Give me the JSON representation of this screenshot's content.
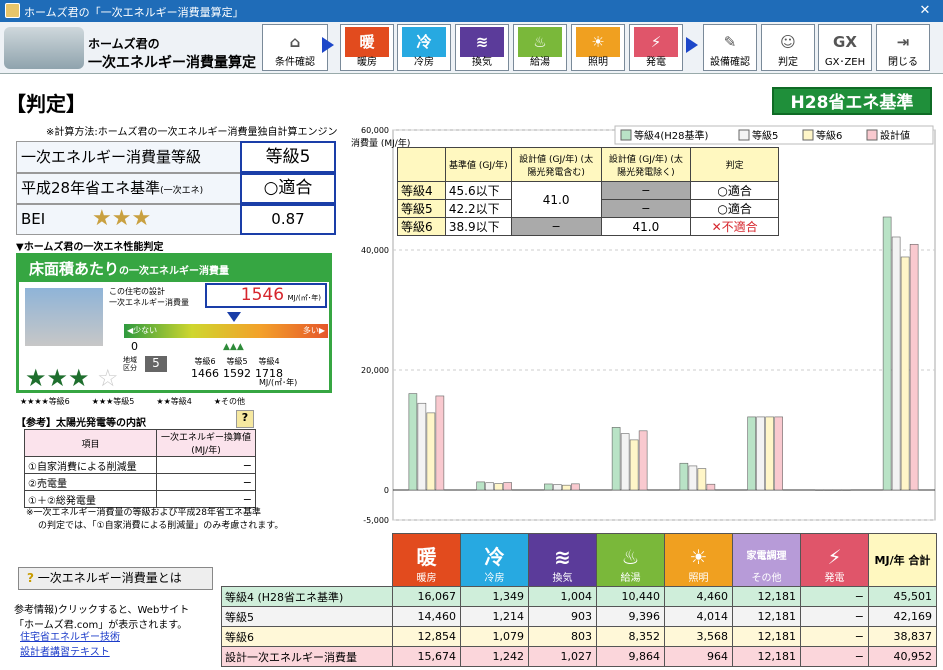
{
  "window": {
    "title": "ホームズ君の「一次エネルギー消費量算定」",
    "close": "✕"
  },
  "logo": {
    "line1": "ホームズ君の",
    "line2": "一次エネルギー消費量算定"
  },
  "toolbar": {
    "buttons": [
      {
        "label": "条件確認",
        "icon": "⌂",
        "color": "#ffffff"
      },
      {
        "label": "暖房",
        "icon": "暖",
        "color": "#e24b1e"
      },
      {
        "label": "冷房",
        "icon": "冷",
        "color": "#27a9e1"
      },
      {
        "label": "換気",
        "icon": "≋",
        "color": "#5b3b9a"
      },
      {
        "label": "給湯",
        "icon": "♨",
        "color": "#7ab83a"
      },
      {
        "label": "照明",
        "icon": "☀",
        "color": "#f0a020"
      },
      {
        "label": "発電",
        "icon": "⚡",
        "color": "#e0556a"
      },
      {
        "label": "設備確認",
        "icon": "✎",
        "color": "#ffffff"
      },
      {
        "label": "判定",
        "icon": "☺",
        "color": "#ffffff"
      },
      {
        "label": "GX･ZEH",
        "icon": "GX",
        "color": "#ffffff"
      },
      {
        "label": "閉じる",
        "icon": "⇥",
        "color": "#ffffff"
      }
    ]
  },
  "page": {
    "title": "【判定】",
    "badge": "H28省エネ基準",
    "method_note": "※計算方法:ホームズ君の一次エネルギー消費量独自計算エンジン"
  },
  "summary": {
    "grade_label": "一次エネルギー消費量等級",
    "grade_value": "等級5",
    "h28_label": "平成28年省エネ基準",
    "h28_sub": "(一次エネ)",
    "h28_value": "○適合",
    "bei_label": "BEI",
    "bei_stars": "★★★",
    "bei_value": "0.87"
  },
  "performance": {
    "heading": "▼ホームズ君の一次エネ性能判定",
    "box_title": "床面積あたり",
    "box_title2": "の一次エネルギー消費量",
    "design_label1": "この住宅の設計",
    "design_label2": "一次エネルギー消費量",
    "design_value": "1546",
    "design_unit": "MJ/(㎡･年)",
    "scale_low": "◀少ない",
    "scale_high": "多い▶",
    "scale_zero": "0",
    "region_label": "地域区分",
    "region_value": "5",
    "grades": [
      {
        "name": "等級6",
        "value": "1466"
      },
      {
        "name": "等級5",
        "value": "1592"
      },
      {
        "name": "等級4",
        "value": "1718"
      }
    ],
    "grade_unit": "MJ/(㎡･年)",
    "stars": "★★★",
    "stars_empty": "☆",
    "legend": [
      "★★★★等級6",
      "★★★等級5",
      "★★等級4",
      "★その他"
    ]
  },
  "solar": {
    "heading": "【参考】太陽光発電等の内訳",
    "col1": "項目",
    "col2": "一次エネルギー換算値 (MJ/年)",
    "rows": [
      {
        "item": "①自家消費による削減量",
        "value": "−"
      },
      {
        "item": "②売電量",
        "value": "−"
      },
      {
        "item": "①＋②総発電量",
        "value": "−"
      }
    ],
    "note1": "※一次エネルギー消費量の等級および平成28年省エネ基準",
    "note2": "の判定では、「①自家消費による削減量」のみ考慮されます。"
  },
  "help": {
    "button": "一次エネルギー消費量とは",
    "info": "参考情報)クリックすると、Webサイト",
    "info2": "「ホームズ君.com」が表示されます。",
    "link1": "住宅省エネルギー技術",
    "link2": "設計者講習テキスト"
  },
  "judge_table": {
    "headers": [
      "基準値 (GJ/年)",
      "設計値 (GJ/年) (太陽光発電含む)",
      "設計値 (GJ/年) (太陽光発電除く)",
      "判定"
    ],
    "rows": [
      {
        "grade": "等級4",
        "base": "45.6以下",
        "with": "41.0",
        "without": "−",
        "result": "○適合"
      },
      {
        "grade": "等級5",
        "base": "42.2以下",
        "with": "",
        "without": "−",
        "result": "○適合"
      },
      {
        "grade": "等級6",
        "base": "38.9以下",
        "with": "−",
        "without": "41.0",
        "result": "✕不適合"
      }
    ]
  },
  "chart_data": {
    "type": "bar",
    "ylabel": "消費量 (MJ/年)",
    "ylim": [
      -5000,
      60000
    ],
    "yticks": [
      "60,000",
      "40,000",
      "20,000",
      "0",
      "-5,000"
    ],
    "categories": [
      "暖房",
      "冷房",
      "換気",
      "給湯",
      "照明",
      "その他",
      "発電",
      "合計"
    ],
    "series": [
      {
        "name": "等級4(H28基準)",
        "color": "#b9e3c6",
        "values": [
          16067,
          1349,
          1004,
          10440,
          4460,
          12181,
          0,
          45501
        ]
      },
      {
        "name": "等級5",
        "color": "#f3f3f3",
        "values": [
          14460,
          1214,
          903,
          9396,
          4014,
          12181,
          0,
          42169
        ]
      },
      {
        "name": "等級6",
        "color": "#fff6c8",
        "values": [
          12854,
          1079,
          803,
          8352,
          3568,
          12181,
          0,
          38837
        ]
      },
      {
        "name": "設計値",
        "color": "#f9c9cf",
        "values": [
          15674,
          1242,
          1027,
          9864,
          964,
          12181,
          0,
          40952
        ]
      }
    ]
  },
  "bottom_table": {
    "headers": [
      {
        "label": "暖房",
        "icon": "暖",
        "color": "#e24b1e"
      },
      {
        "label": "冷房",
        "icon": "冷",
        "color": "#27a9e1"
      },
      {
        "label": "換気",
        "icon": "≋",
        "color": "#5b3b9a"
      },
      {
        "label": "給湯",
        "icon": "♨",
        "color": "#7ab83a"
      },
      {
        "label": "照明",
        "icon": "☀",
        "color": "#f0a020"
      },
      {
        "label": "その他",
        "icon": "家電調理",
        "color": "#b79bd8"
      },
      {
        "label": "発電",
        "icon": "⚡",
        "color": "#e0556a"
      }
    ],
    "total_header": "MJ/年 合計",
    "rows": [
      {
        "label": "等級4 (H28省エネ基準)",
        "bg": "#cfeeda",
        "v": [
          "16,067",
          "1,349",
          "1,004",
          "10,440",
          "4,460",
          "12,181",
          "−",
          "45,501"
        ]
      },
      {
        "label": "等級5",
        "bg": "#f3f3f3",
        "v": [
          "14,460",
          "1,214",
          "903",
          "9,396",
          "4,014",
          "12,181",
          "−",
          "42,169"
        ]
      },
      {
        "label": "等級6",
        "bg": "#fff8d8",
        "v": [
          "12,854",
          "1,079",
          "803",
          "8,352",
          "3,568",
          "12,181",
          "−",
          "38,837"
        ]
      },
      {
        "label": "設計一次エネルギー消費量",
        "bg": "#fbd6db",
        "v": [
          "15,674",
          "1,242",
          "1,027",
          "9,864",
          "964",
          "12,181",
          "−",
          "40,952"
        ]
      }
    ]
  }
}
